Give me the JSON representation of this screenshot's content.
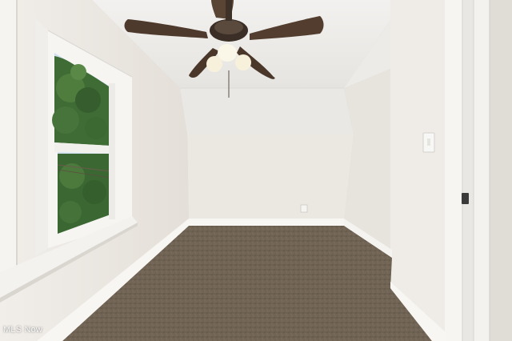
{
  "scene": {
    "description_colors": {
      "ceiling": "#ecebe8",
      "wall": "#ece8e2",
      "trim": "#f7f6f3",
      "carpet": "#6e6253",
      "fan_blade": "#4e3a2c",
      "foliage": "#3e6a34"
    }
  },
  "watermark": {
    "text": "MLS Now"
  }
}
